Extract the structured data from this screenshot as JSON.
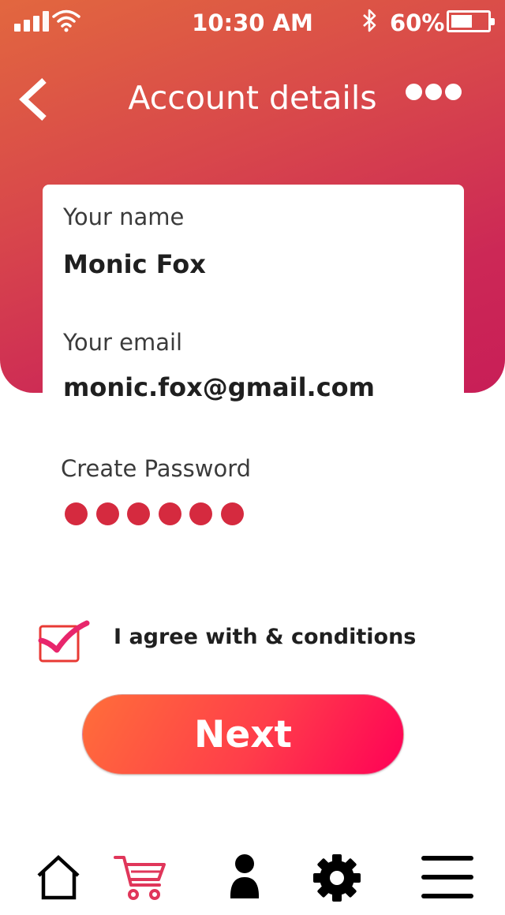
{
  "status_bar": {
    "time": "10:30 AM",
    "battery_percent": "60%",
    "battery_level": 0.6,
    "icons": [
      "signal-icon",
      "wifi-icon",
      "bluetooth-icon",
      "battery-icon"
    ]
  },
  "header": {
    "title": "Account details",
    "back_icon": "chevron-left-icon",
    "more_icon": "more-horizontal-icon"
  },
  "form": {
    "name_label": "Your name",
    "name_value": "Monic Fox",
    "email_label": "Your email",
    "email_value": "monic.fox@gmail.com",
    "password_label": "Create Password",
    "password_masked_length": 6
  },
  "agree": {
    "checked": true,
    "label": "I agree with & conditions"
  },
  "next_button": {
    "label": "Next"
  },
  "bottom_nav": {
    "items": [
      "home-icon",
      "cart-icon",
      "user-icon",
      "gear-icon",
      "menu-icon"
    ],
    "active": "cart-icon"
  },
  "colors": {
    "header_gradient_start": "#e2673f",
    "header_gradient_end": "#c81e57",
    "password_dot": "#d52a3f",
    "button_gradient_start": "#ff6e3a",
    "button_gradient_end": "#ff0057",
    "cart_active": "#e0365a",
    "checkmark": "#e8266c",
    "checkbox_border": "#e83a34"
  }
}
